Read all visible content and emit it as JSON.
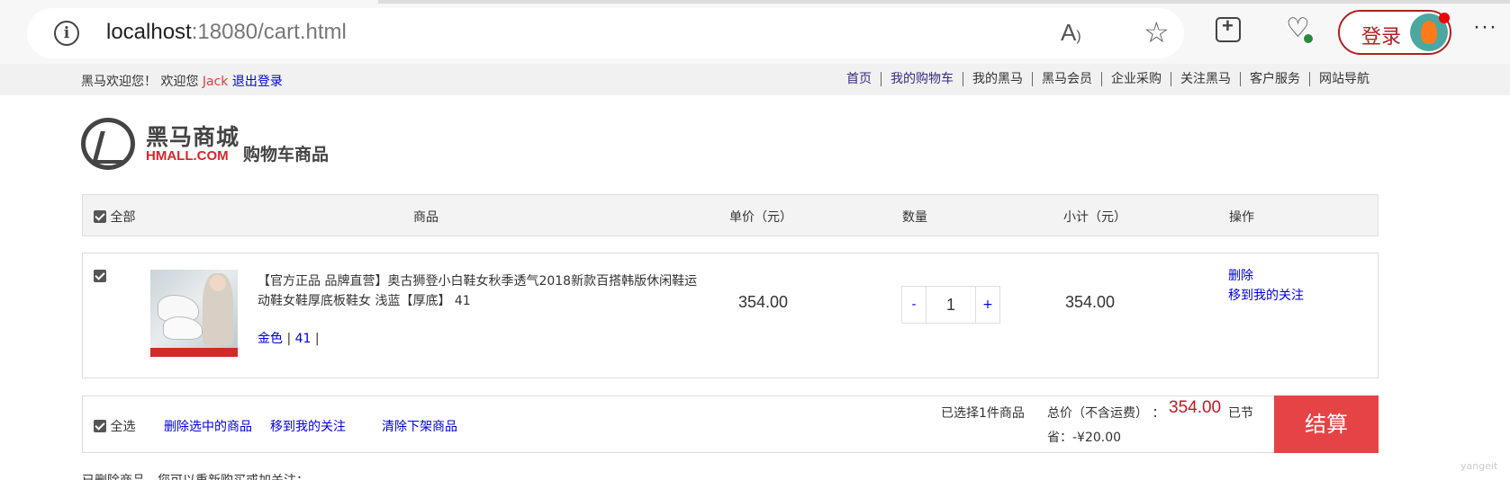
{
  "browser": {
    "url_host": "localhost",
    "url_rest": ":18080/cart.html",
    "login_label": "登录",
    "more": "···"
  },
  "topbar": {
    "welcome_prefix": "黑马欢迎您！ 欢迎您 ",
    "user": "Jack",
    "logout": " 退出登录",
    "nav": [
      "首页",
      "我的购物车",
      "我的黑马",
      "黑马会员",
      "企业采购",
      "关注黑马",
      "客户服务",
      "网站导航"
    ]
  },
  "header": {
    "logo_cn": "黑马商城",
    "logo_en": "HMALL.COM",
    "page_title": "购物车商品"
  },
  "cart_header": {
    "select_all": "全部",
    "product": "商品",
    "price": "单价（元）",
    "quantity": "数量",
    "subtotal": "小计（元）",
    "actions": "操作"
  },
  "item": {
    "title": "【官方正品 品牌直营】奥古狮登小白鞋女秋季透气2018新款百搭韩版休闲鞋运动鞋女鞋厚底板鞋女 浅蓝【厚底】 41",
    "attr_color": "金色",
    "attr_size": "41",
    "price": "354.00",
    "minus": "-",
    "quantity": "1",
    "plus": "+",
    "subtotal": "354.00",
    "delete": "删除",
    "move_to_follow": "移到我的关注"
  },
  "footer": {
    "select_all": "全选",
    "delete_selected": "删除选中的商品",
    "move_to_follow": "移到我的关注",
    "clear_offshelf": "清除下架商品",
    "selected_count": "已选择1件商品",
    "total_label": "总价（不含运费） ：",
    "total": "354.00",
    "saved_tail": "已节",
    "saved": "省：-¥20.00",
    "checkout": "结算"
  },
  "deleted_note": "已删除商品，您可以重新购买或加关注：",
  "watermark": "yangeit"
}
